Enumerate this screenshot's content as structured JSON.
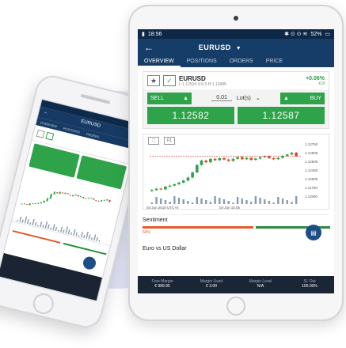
{
  "tablet": {
    "status": {
      "time": "18:56",
      "signal": "▮",
      "icons": "✱ ⊙ ⊙ ≋",
      "battery": "52%"
    },
    "header": {
      "title": "EURUSD"
    },
    "tabs": [
      "OVERVIEW",
      "POSITIONS",
      "ORDERS",
      "PRICE"
    ],
    "symbol": {
      "name": "EURUSD",
      "sub": "L:1.12534  S:0.5  H:1.12885",
      "change_pct": "+0.06%",
      "change_pts": "-6.8"
    },
    "trade": {
      "sell_label": "SELL",
      "buy_label": "BUY",
      "qty_value": "0.01",
      "qty_unit": "Lot(s)",
      "sell_price": "1.12582",
      "buy_price": "1.12587"
    },
    "chart_tools": [
      "⛶",
      "F1"
    ],
    "chart_data": {
      "type": "candlestick",
      "y_ticks": [
        "1.12750",
        "1.12600",
        "1.12500",
        "1.12250",
        "1.12000",
        "1.11750",
        "1.11500"
      ],
      "x_ticks": [
        "03 Jun 2019  UTC+0",
        "04 Jun 10:05"
      ],
      "ylim": [
        1.114,
        1.128
      ],
      "closes": [
        1.1158,
        1.1162,
        1.116,
        1.1168,
        1.1171,
        1.1175,
        1.118,
        1.1186,
        1.1195,
        1.121,
        1.1232,
        1.1245,
        1.124,
        1.125,
        1.1246,
        1.1252,
        1.1248,
        1.1244,
        1.125,
        1.1255,
        1.1249,
        1.1253,
        1.1247,
        1.1251,
        1.1255,
        1.1258,
        1.1252,
        1.1249,
        1.1253,
        1.1259,
        1.1263,
        1.1268,
        1.1258
      ],
      "volume_hint": "bars",
      "current_price": "1.12582"
    },
    "sentiment": {
      "title": "Sentiment",
      "sell_pct": "64%",
      "fab_icon": "▤"
    },
    "next_card": {
      "title": "Euro vs US Dollar"
    },
    "metrics": [
      {
        "label": "Free Margin",
        "value": "€ 989.95"
      },
      {
        "label": "Margin Used",
        "value": "€ 3.00"
      },
      {
        "label": "Margin Level",
        "value": "N/A"
      },
      {
        "label": "Sl. Out",
        "value": "100.00%"
      }
    ]
  },
  "phone": {
    "header": {
      "title": "EURUSD",
      "back": "←"
    },
    "tabs": [
      "OVERVIEW",
      "POSITIONS",
      "ORDERS"
    ],
    "prices": [
      "1.1258",
      "1.1258"
    ]
  },
  "colors": {
    "navy": "#163d68",
    "green": "#2fa34a",
    "red": "#e85a29",
    "dark": "#1a2535"
  }
}
